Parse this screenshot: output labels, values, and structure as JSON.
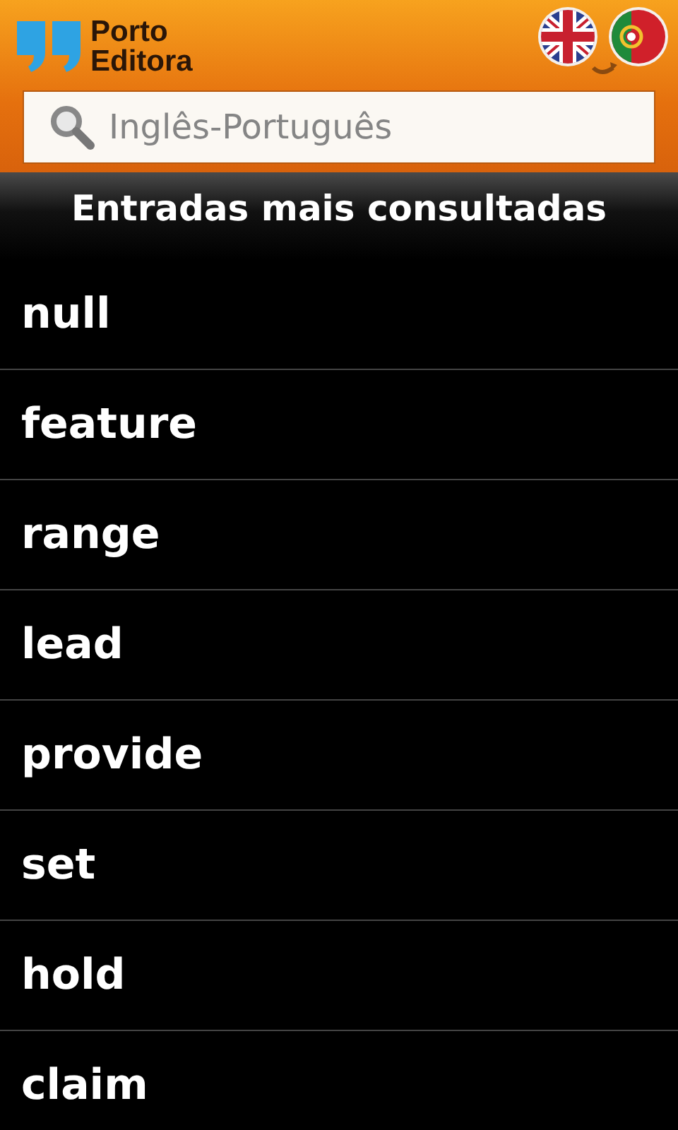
{
  "header": {
    "logo_lines": [
      "Porto",
      "Editora"
    ]
  },
  "search": {
    "placeholder": "Inglês-Português"
  },
  "section_title": "Entradas mais consultadas",
  "entries": [
    "null",
    "feature",
    "range",
    "lead",
    "provide",
    "set",
    "hold",
    "claim"
  ]
}
